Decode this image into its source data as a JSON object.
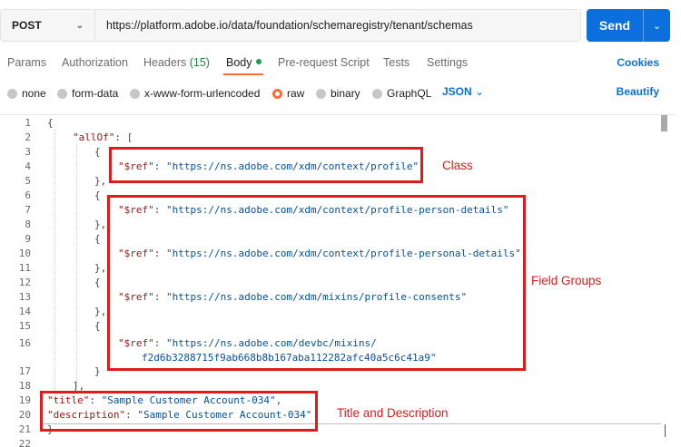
{
  "request": {
    "method": "POST",
    "url": "https://platform.adobe.io/data/foundation/schemaregistry/tenant/schemas",
    "send_label": "Send"
  },
  "tabs": {
    "params": "Params",
    "authorization": "Authorization",
    "headers": "Headers",
    "headers_count": "(15)",
    "body": "Body",
    "prerequest": "Pre-request Script",
    "tests": "Tests",
    "settings": "Settings",
    "cookies": "Cookies"
  },
  "body_types": {
    "none": "none",
    "form_data": "form-data",
    "urlencoded": "x-www-form-urlencoded",
    "raw": "raw",
    "binary": "binary",
    "graphql": "GraphQL",
    "language": "JSON",
    "beautify": "Beautify",
    "selected": "raw"
  },
  "colors": {
    "send_button": "#0b6fde",
    "active_tab_underline": "#ff6c37",
    "annotation": "#e01b1b",
    "json_key": "#a31515",
    "json_string": "#0451a5"
  },
  "editor": {
    "line_numbers": [
      "1",
      "2",
      "3",
      "4",
      "5",
      "6",
      "7",
      "8",
      "9",
      "10",
      "11",
      "12",
      "13",
      "14",
      "15",
      "16",
      "17",
      "18",
      "19",
      "20",
      "21",
      "22"
    ],
    "open_brace": "{",
    "allof_key": "\"allOf\"",
    "allof_punct": ": [",
    "obj_open": "{",
    "obj_close_comma": "},",
    "obj_close": "}",
    "array_close": "],",
    "close_brace": "}",
    "ref_key": "\"$ref\"",
    "colon": ": ",
    "comma": ",",
    "refs": [
      "\"https://ns.adobe.com/xdm/context/profile\"",
      "\"https://ns.adobe.com/xdm/context/profile-person-details\"",
      "\"https://ns.adobe.com/xdm/context/profile-personal-details\"",
      "\"https://ns.adobe.com/xdm/mixins/profile-consents\"",
      "\"https://ns.adobe.com/devbc/mixins/",
      "f2d6b3288715f9ab668b8b167aba112282afc40a5c6c41a9\""
    ],
    "title_key": "\"title\"",
    "title_value": "\"Sample Customer Account-034\"",
    "description_key": "\"description\"",
    "description_value": "\"Sample Customer Account-034\""
  },
  "annotations": {
    "class": "Class",
    "field_groups": "Field Groups",
    "title_description": "Title and Description"
  }
}
